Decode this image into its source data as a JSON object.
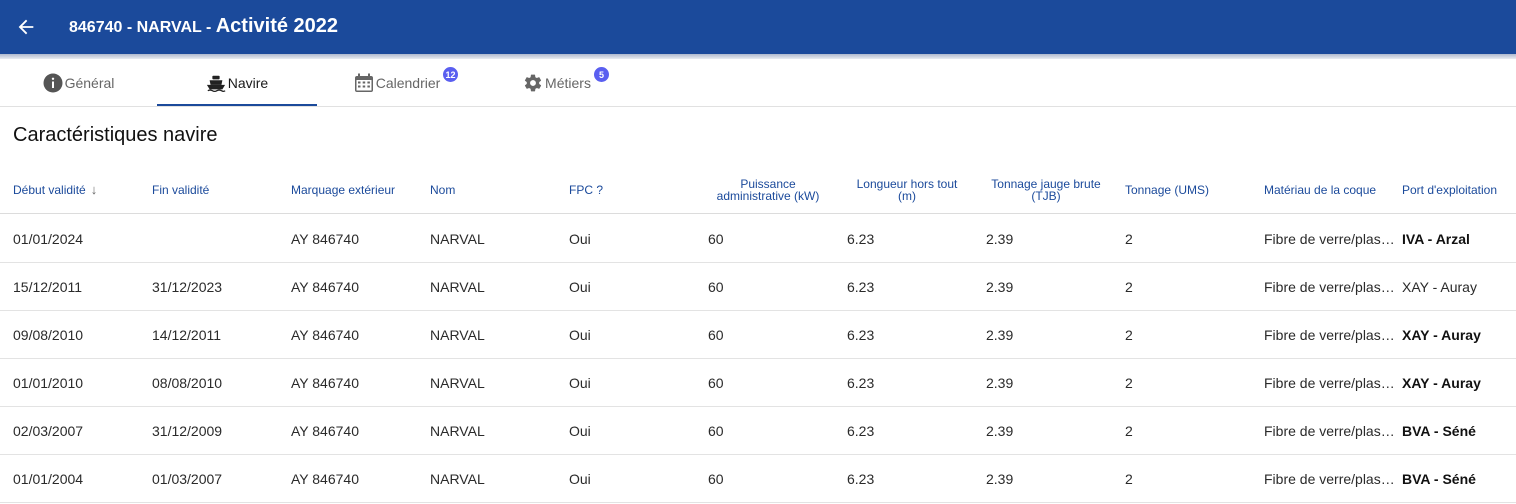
{
  "header": {
    "subtitle": "846740 - NARVAL - ",
    "title": "Activité 2022",
    "background": "#1b4a9b"
  },
  "tabs": [
    {
      "label": "Général",
      "icon": "info-icon",
      "badge": null
    },
    {
      "label": "Navire",
      "icon": "ship-icon",
      "badge": null,
      "active": true
    },
    {
      "label": "Calendrier",
      "icon": "calendar-icon",
      "badge": "12"
    },
    {
      "label": "Métiers",
      "icon": "gear-icon",
      "badge": "5"
    }
  ],
  "section": {
    "title": "Caractéristiques navire"
  },
  "table": {
    "columns": [
      "Début validité",
      "Fin validité",
      "Marquage extérieur",
      "Nom",
      "FPC ?",
      "Puissance administrative (kW)",
      "Longueur hors tout (m)",
      "Tonnage jauge brute (TJB)",
      "Tonnage (UMS)",
      "Matériau de la coque",
      "Port d'exploitation"
    ],
    "rows": [
      [
        "01/01/2024",
        "",
        "AY 846740",
        "NARVAL",
        "Oui",
        "60",
        "6.23",
        "2.39",
        "2",
        "Fibre de verre/plastique",
        "IVA - Arzal"
      ],
      [
        "15/12/2011",
        "31/12/2023",
        "AY 846740",
        "NARVAL",
        "Oui",
        "60",
        "6.23",
        "2.39",
        "2",
        "Fibre de verre/plastique",
        "XAY - Auray"
      ],
      [
        "09/08/2010",
        "14/12/2011",
        "AY 846740",
        "NARVAL",
        "Oui",
        "60",
        "6.23",
        "2.39",
        "2",
        "Fibre de verre/plastique",
        "XAY - Auray"
      ],
      [
        "01/01/2010",
        "08/08/2010",
        "AY 846740",
        "NARVAL",
        "Oui",
        "60",
        "6.23",
        "2.39",
        "2",
        "Fibre de verre/plastique",
        "XAY - Auray"
      ],
      [
        "02/03/2007",
        "31/12/2009",
        "AY 846740",
        "NARVAL",
        "Oui",
        "60",
        "6.23",
        "2.39",
        "2",
        "Fibre de verre/plastique",
        "BVA - Séné"
      ],
      [
        "01/01/2004",
        "01/03/2007",
        "AY 846740",
        "NARVAL",
        "Oui",
        "60",
        "6.23",
        "2.39",
        "2",
        "Fibre de verre/plastique",
        "BVA - Séné"
      ]
    ],
    "port_bold": [
      true,
      false,
      true,
      true,
      true,
      true
    ]
  }
}
